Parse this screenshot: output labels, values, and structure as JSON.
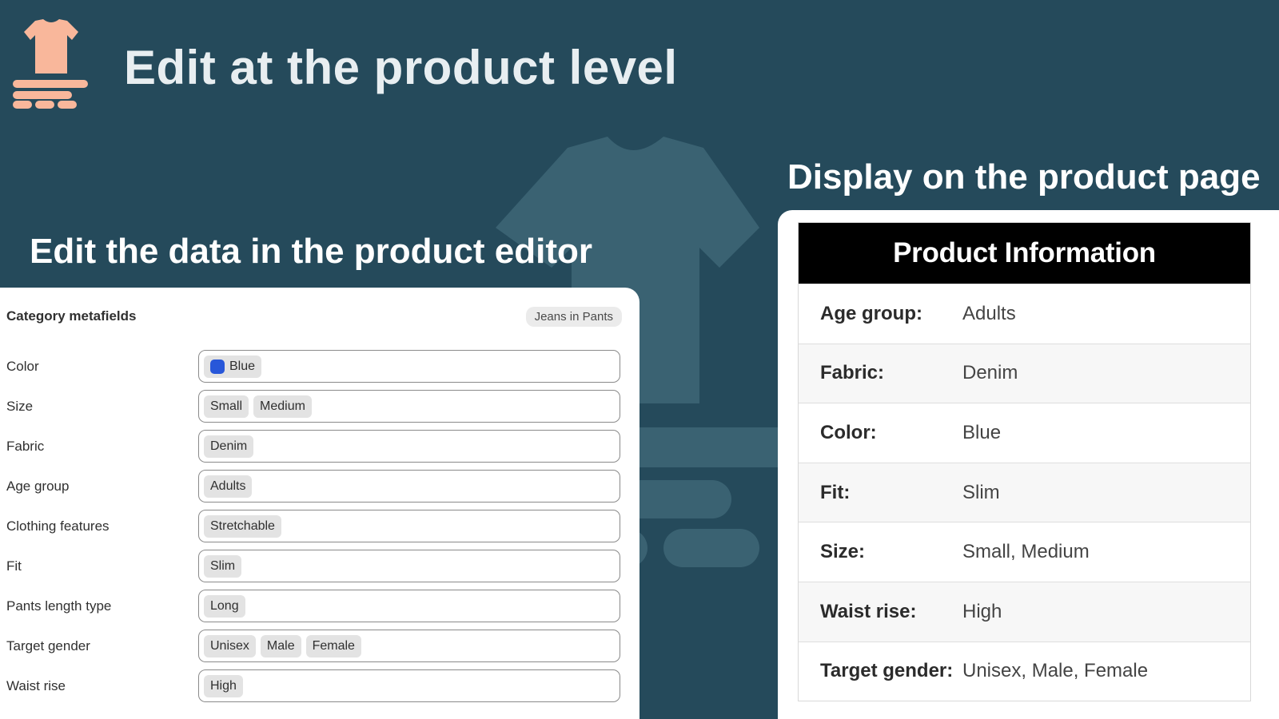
{
  "header": {
    "title": "Edit at the product level",
    "logo_icon": "tshirt-shelf-icon",
    "accent_color": "#f9b79b"
  },
  "colors": {
    "background": "#254a5b",
    "decoration": "#3a6272"
  },
  "editor": {
    "heading": "Edit the data in the product editor",
    "panel_title": "Category metafields",
    "category_badge": "Jeans in Pants",
    "fields": [
      {
        "label": "Color",
        "tags": [
          "Blue"
        ],
        "swatch_color": "#2857d9"
      },
      {
        "label": "Size",
        "tags": [
          "Small",
          "Medium"
        ]
      },
      {
        "label": "Fabric",
        "tags": [
          "Denim"
        ]
      },
      {
        "label": "Age group",
        "tags": [
          "Adults"
        ]
      },
      {
        "label": "Clothing features",
        "tags": [
          "Stretchable"
        ]
      },
      {
        "label": "Fit",
        "tags": [
          "Slim"
        ]
      },
      {
        "label": "Pants length type",
        "tags": [
          "Long"
        ]
      },
      {
        "label": "Target gender",
        "tags": [
          "Unisex",
          "Male",
          "Female"
        ]
      },
      {
        "label": "Waist rise",
        "tags": [
          "High"
        ]
      }
    ]
  },
  "display": {
    "heading": "Display on the product page",
    "table_title": "Product Information",
    "rows": [
      {
        "key": "Age group:",
        "value": "Adults"
      },
      {
        "key": "Fabric:",
        "value": "Denim"
      },
      {
        "key": "Color:",
        "value": "Blue"
      },
      {
        "key": "Fit:",
        "value": "Slim"
      },
      {
        "key": "Size:",
        "value": "Small, Medium"
      },
      {
        "key": "Waist rise:",
        "value": "High"
      },
      {
        "key": "Target gender:",
        "value": "Unisex, Male, Female"
      }
    ]
  }
}
